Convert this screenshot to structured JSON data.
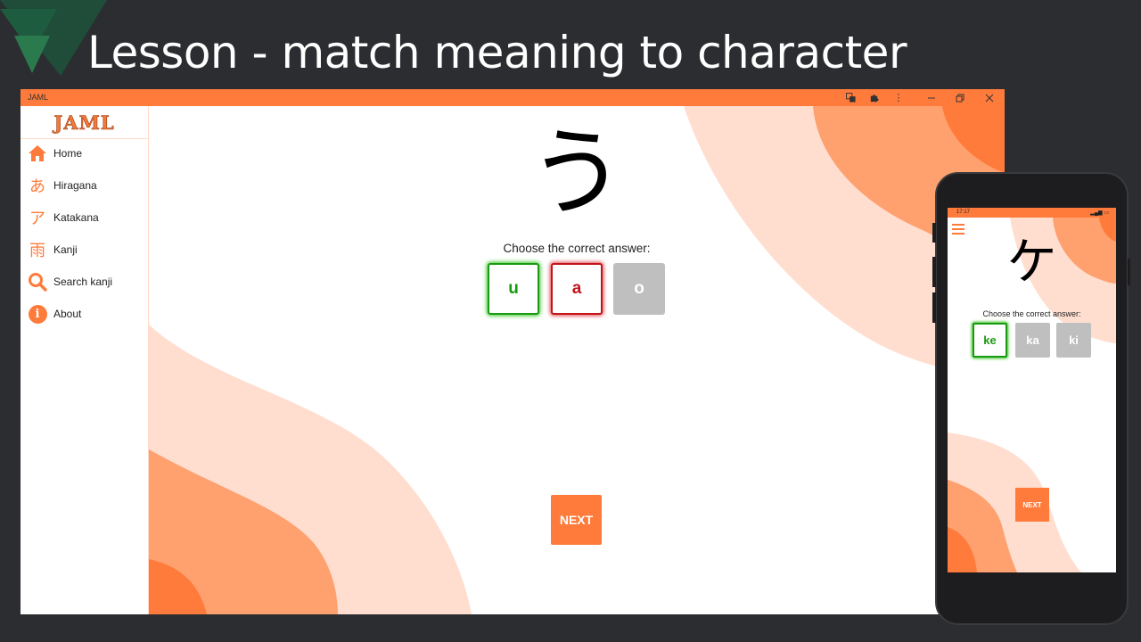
{
  "slide": {
    "title": "Lesson - match meaning to character"
  },
  "colors": {
    "brand_orange": "#ff7b3b",
    "correct_green": "#1a9a12",
    "wrong_red": "#c2141a",
    "neutral_gray": "#bfbfbf",
    "slide_background": "#2b2d30"
  },
  "desktop": {
    "window_title": "JAML",
    "titlebar_icons": [
      "translate-icon",
      "extensions-icon",
      "more-vert-icon",
      "minimize-icon",
      "restore-icon",
      "close-icon"
    ],
    "logo_text": "JAML",
    "nav": [
      {
        "label": "Home",
        "icon": "home-icon"
      },
      {
        "label": "Hiragana",
        "icon": "hiragana-a-icon",
        "glyph": "あ"
      },
      {
        "label": "Katakana",
        "icon": "katakana-a-icon",
        "glyph": "ア"
      },
      {
        "label": "Kanji",
        "icon": "kanji-rain-icon",
        "glyph": "雨"
      },
      {
        "label": "Search kanji",
        "icon": "search-icon"
      },
      {
        "label": "About",
        "icon": "info-icon",
        "glyph": "i"
      }
    ],
    "lesson": {
      "character": "う",
      "prompt": "Choose the correct answer:",
      "answers": [
        {
          "label": "u",
          "state": "correct"
        },
        {
          "label": "a",
          "state": "wrong"
        },
        {
          "label": "o",
          "state": "neutral"
        }
      ],
      "next_label": "NEXT"
    }
  },
  "phone": {
    "status_time": "17:17",
    "status_icons": "▂▄▆ ▭",
    "lesson": {
      "character": "ケ",
      "prompt": "Choose the correct answer:",
      "answers": [
        {
          "label": "ke",
          "state": "correct"
        },
        {
          "label": "ka",
          "state": "neutral"
        },
        {
          "label": "ki",
          "state": "neutral"
        }
      ],
      "next_label": "NEXT"
    }
  }
}
